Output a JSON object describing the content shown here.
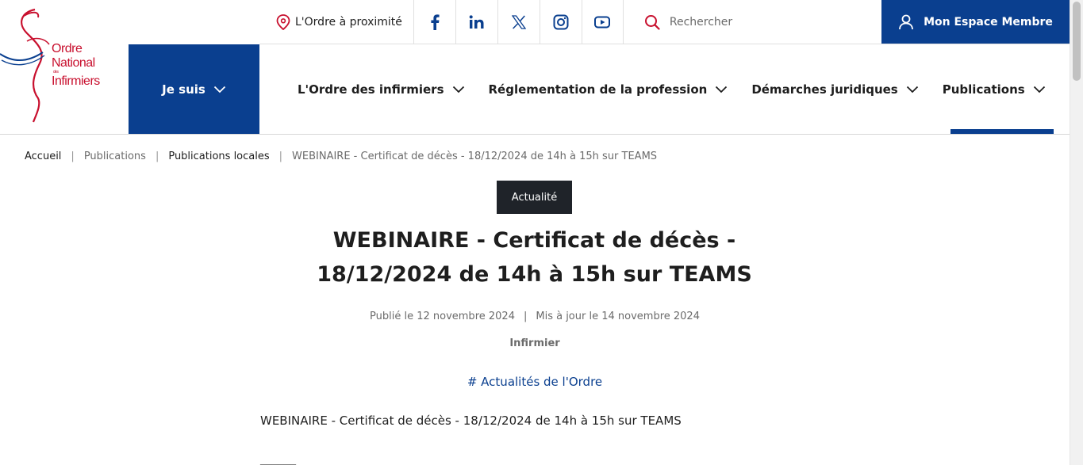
{
  "logo": {
    "line1": "Ordre",
    "line2": "National",
    "line_small": "des",
    "line3": "Infirmiers",
    "color": "#c8102e"
  },
  "topbar": {
    "locator_label": "L'Ordre à proximité",
    "social": [
      "facebook-icon",
      "linkedin-icon",
      "x-icon",
      "instagram-icon",
      "youtube-icon"
    ],
    "search_placeholder": "Rechercher",
    "member_label": "Mon Espace Membre"
  },
  "nav": {
    "jesuis": "Je suis",
    "items": [
      {
        "label": "L'Ordre des infirmiers"
      },
      {
        "label": "Réglementation de la profession"
      },
      {
        "label": "Démarches juridiques"
      },
      {
        "label": "Publications"
      }
    ]
  },
  "breadcrumb": [
    "Accueil",
    "Publications",
    "Publications locales",
    "WEBINAIRE - Certificat de décès - 18/12/2024 de 14h à 15h sur TEAMS"
  ],
  "article": {
    "badge": "Actualité",
    "title_line1": "WEBINAIRE - Certificat de décès -",
    "title_line2": "18/12/2024 de 14h à 15h sur TEAMS",
    "published": "Publié le 12 novembre 2024",
    "updated": "Mis à jour le 14 novembre 2024",
    "audience": "Infirmier",
    "tag": "# Actualités de l'Ordre",
    "body": "WEBINAIRE - Certificat de décès - 18/12/2024 de 14h à 15h sur TEAMS",
    "divider": "______"
  },
  "colors": {
    "brand_blue": "#0a3f8f",
    "brand_red": "#c8102e",
    "badge_bg": "#1f2329"
  }
}
